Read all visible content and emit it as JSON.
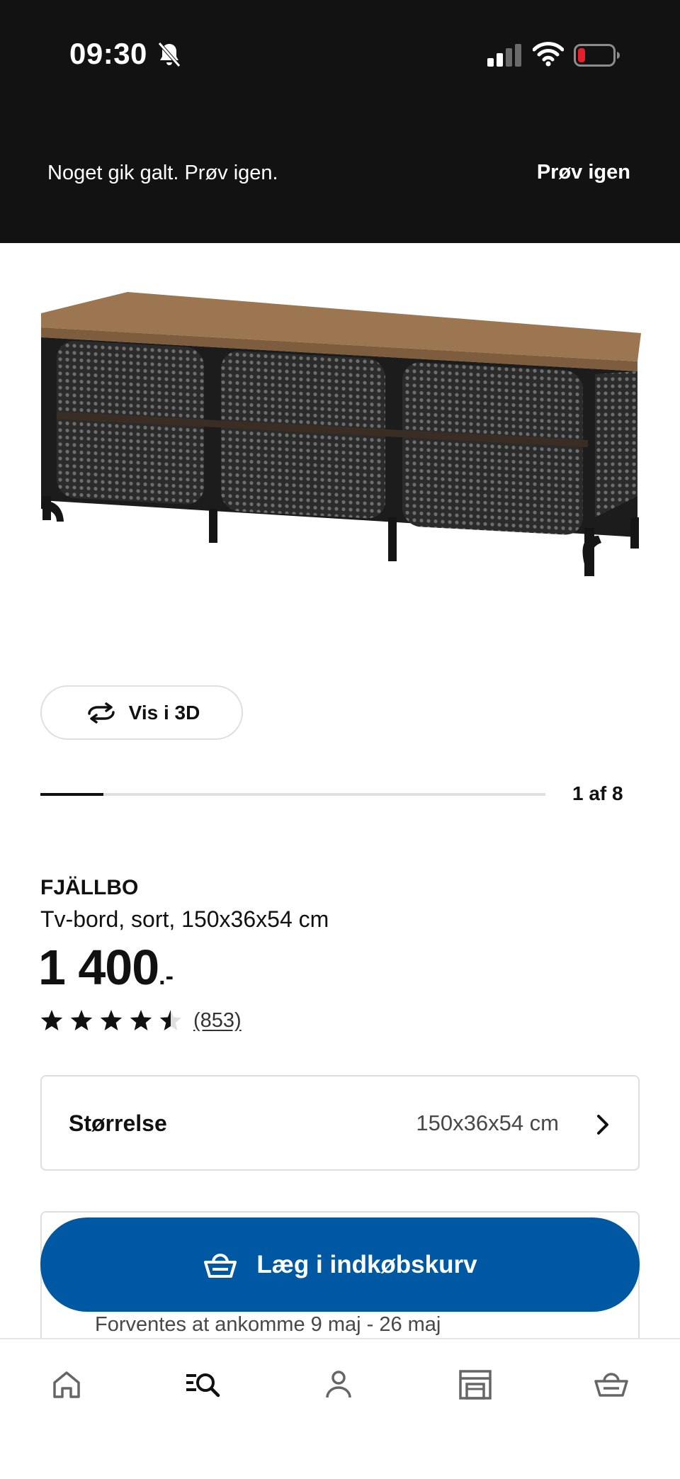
{
  "status_bar": {
    "time": "09:30",
    "icons": [
      "bell-off-icon",
      "cellular-signal-icon",
      "wifi-icon",
      "battery-low-icon"
    ],
    "battery_color": "#e5202a"
  },
  "banner": {
    "message": "Noget gik galt. Prøv igen.",
    "retry_label": "Prøv igen",
    "background": "#121212"
  },
  "gallery": {
    "view_3d_label": "Vis i 3D",
    "position_label": "1 af 8",
    "progress_fraction": 0.125
  },
  "product": {
    "name": "FJÄLLBO",
    "description": "Tv-bord, sort, 150x36x54 cm",
    "price": "1 400",
    "price_suffix": ".-",
    "rating_value": 4.5,
    "rating_max": 5,
    "review_count": "(853)"
  },
  "size": {
    "label": "Størrelse",
    "value": "150x36x54 cm"
  },
  "purchase": {
    "add_to_cart_label": "Læg i indkøbskurv",
    "delivery_text": "Forventes at ankomme 9 maj - 26 maj",
    "button_color": "#0058a3"
  },
  "bottom_nav": {
    "items": [
      {
        "icon": "home-icon",
        "active": false
      },
      {
        "icon": "search-list-icon",
        "active": true
      },
      {
        "icon": "profile-icon",
        "active": false
      },
      {
        "icon": "store-icon",
        "active": false
      },
      {
        "icon": "cart-icon",
        "active": false
      }
    ]
  }
}
